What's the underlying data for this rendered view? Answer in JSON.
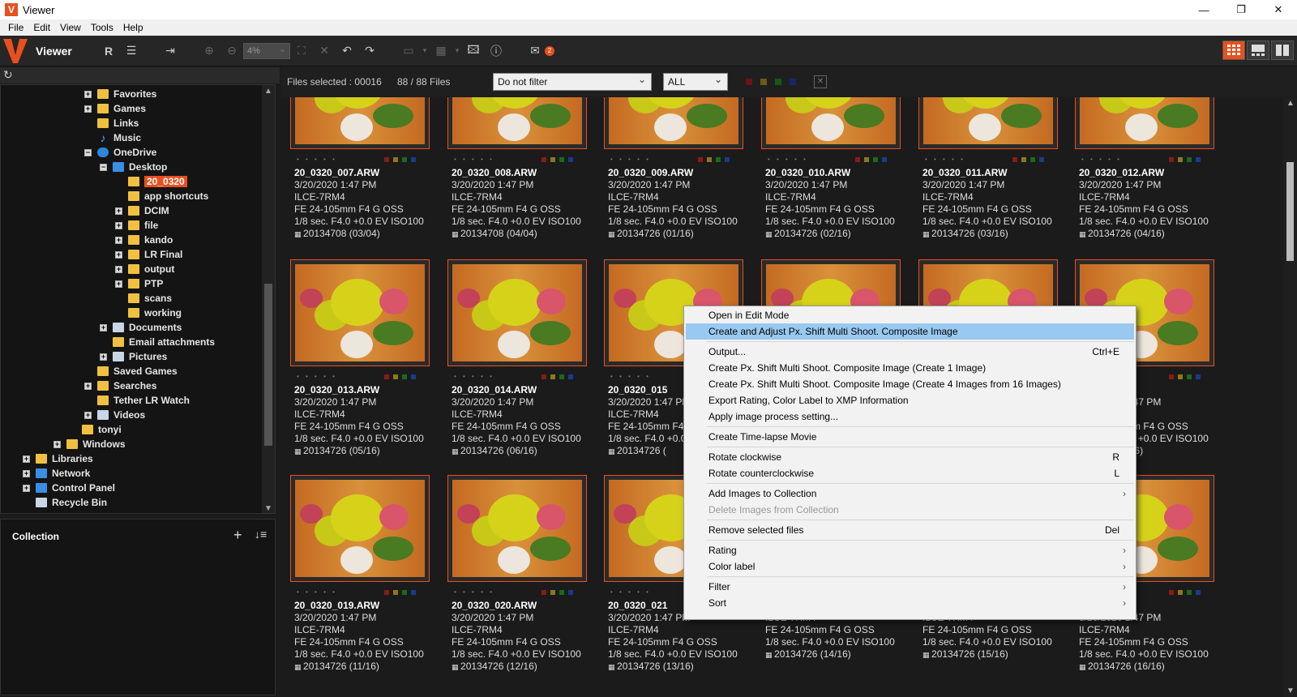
{
  "window": {
    "title": "Viewer",
    "app_icon_letter": "V",
    "controls": [
      "—",
      "❐",
      "✕"
    ]
  },
  "menubar": [
    "File",
    "Edit",
    "View",
    "Tools",
    "Help"
  ],
  "toolbar": {
    "app_name": "Viewer",
    "zoom_value": "4%",
    "mail_badge": "2"
  },
  "tree": {
    "items": [
      {
        "label": "Favorites",
        "level": 5,
        "exp": true,
        "icon": "folder"
      },
      {
        "label": "Games",
        "level": 5,
        "exp": true,
        "icon": "folder"
      },
      {
        "label": "Links",
        "level": 5,
        "exp": false,
        "icon": "folder"
      },
      {
        "label": "Music",
        "level": 5,
        "exp": false,
        "icon": "music"
      },
      {
        "label": "OneDrive",
        "level": 5,
        "exp": "minus",
        "icon": "cloud"
      },
      {
        "label": "Desktop",
        "level": 6,
        "exp": "minus",
        "icon": "blue"
      },
      {
        "label": "20_0320",
        "level": 7,
        "exp": false,
        "icon": "folder",
        "selected": true
      },
      {
        "label": "app shortcuts",
        "level": 7,
        "exp": false,
        "icon": "folder"
      },
      {
        "label": "DCIM",
        "level": 7,
        "exp": true,
        "icon": "folder"
      },
      {
        "label": "file",
        "level": 7,
        "exp": true,
        "icon": "folder"
      },
      {
        "label": "kando",
        "level": 7,
        "exp": true,
        "icon": "folder"
      },
      {
        "label": "LR Final",
        "level": 7,
        "exp": true,
        "icon": "folder"
      },
      {
        "label": "output",
        "level": 7,
        "exp": true,
        "icon": "folder"
      },
      {
        "label": "PTP",
        "level": 7,
        "exp": true,
        "icon": "folder"
      },
      {
        "label": "scans",
        "level": 7,
        "exp": false,
        "icon": "folder"
      },
      {
        "label": "working",
        "level": 7,
        "exp": false,
        "icon": "folder"
      },
      {
        "label": "Documents",
        "level": 6,
        "exp": true,
        "icon": "special"
      },
      {
        "label": "Email attachments",
        "level": 6,
        "exp": false,
        "icon": "folder"
      },
      {
        "label": "Pictures",
        "level": 6,
        "exp": true,
        "icon": "special"
      },
      {
        "label": "Saved Games",
        "level": 5,
        "exp": false,
        "icon": "folder"
      },
      {
        "label": "Searches",
        "level": 5,
        "exp": true,
        "icon": "folder"
      },
      {
        "label": "Tether LR Watch",
        "level": 5,
        "exp": false,
        "icon": "folder"
      },
      {
        "label": "Videos",
        "level": 5,
        "exp": true,
        "icon": "special"
      },
      {
        "label": "tonyi",
        "level": 4,
        "exp": false,
        "icon": "folder"
      },
      {
        "label": "Windows",
        "level": 3,
        "exp": true,
        "icon": "folder"
      },
      {
        "label": "Libraries",
        "level": 1,
        "exp": true,
        "icon": "folder"
      },
      {
        "label": "Network",
        "level": 1,
        "exp": true,
        "icon": "blue"
      },
      {
        "label": "Control Panel",
        "level": 1,
        "exp": true,
        "icon": "blue"
      },
      {
        "label": "Recycle Bin",
        "level": 1,
        "exp": false,
        "icon": "special"
      }
    ]
  },
  "collection": {
    "title": "Collection",
    "add_icon": "+",
    "sort_icon": "↓≡"
  },
  "filterbar": {
    "files_selected": "Files selected : 00016",
    "files_count": "88 / 88 Files",
    "filter_value": "Do not filter",
    "rating_value": "ALL",
    "clear_icon": "✕"
  },
  "grid": {
    "rows": [
      {
        "cells": [
          {
            "name": "20_0320_007.ARW",
            "serial": "20134708 (03/04)"
          },
          {
            "name": "20_0320_008.ARW",
            "serial": "20134708 (04/04)"
          },
          {
            "name": "20_0320_009.ARW",
            "serial": "20134726 (01/16)"
          },
          {
            "name": "20_0320_010.ARW",
            "serial": "20134726 (02/16)"
          },
          {
            "name": "20_0320_011.ARW",
            "serial": "20134726 (03/16)"
          },
          {
            "name": "20_0320_012.ARW",
            "serial": "20134726 (04/16)"
          }
        ]
      },
      {
        "cells": [
          {
            "name": "20_0320_013.ARW",
            "serial": "20134726 (05/16)"
          },
          {
            "name": "20_0320_014.ARW",
            "serial": "20134726 (06/16)"
          },
          {
            "name": "20_0320_015",
            "serial": "20134726 ("
          },
          {
            "name": "",
            "serial": ""
          },
          {
            "name": "",
            "serial": ""
          },
          {
            "name": "0_018.ARW",
            "serial": "4726 (10/16)"
          }
        ]
      },
      {
        "cells": [
          {
            "name": "20_0320_019.ARW",
            "serial": "20134726 (11/16)"
          },
          {
            "name": "20_0320_020.ARW",
            "serial": "20134726 (12/16)"
          },
          {
            "name": "20_0320_021",
            "serial": "20134726 (13/16)"
          },
          {
            "name": "",
            "serial": "20134726 (14/16)"
          },
          {
            "name": "",
            "serial": "20134726 (15/16)"
          },
          {
            "name": "0_024.ARW",
            "serial": "20134726 (16/16)"
          }
        ]
      }
    ],
    "date": "3/20/2020 1:47 PM",
    "camera": "ILCE-7RM4",
    "lens": "FE 24-105mm F4 G OSS",
    "exposure": "1/8 sec. F4.0 +0.0 EV ISO100",
    "rating_dots": "• • • • •"
  },
  "context_menu": {
    "items": [
      {
        "label": "Open in Edit Mode",
        "shortcut": "",
        "sub": false
      },
      {
        "label": "Create and Adjust Px. Shift Multi Shoot. Composite Image",
        "shortcut": "",
        "sub": false,
        "highlight": true
      },
      {
        "sep": true
      },
      {
        "label": "Output...",
        "shortcut": "Ctrl+E",
        "sub": false
      },
      {
        "label": "Create Px. Shift Multi Shoot. Composite Image (Create 1 Image)",
        "shortcut": "",
        "sub": false
      },
      {
        "label": "Create Px. Shift Multi Shoot. Composite Image (Create 4 Images from 16 Images)",
        "shortcut": "",
        "sub": false
      },
      {
        "label": "Export Rating, Color Label to XMP Information",
        "shortcut": "",
        "sub": false
      },
      {
        "label": "Apply image process setting...",
        "shortcut": "",
        "sub": false
      },
      {
        "sep": true
      },
      {
        "label": "Create Time-lapse Movie",
        "shortcut": "",
        "sub": false
      },
      {
        "sep": true
      },
      {
        "label": "Rotate clockwise",
        "shortcut": "R",
        "sub": false
      },
      {
        "label": "Rotate counterclockwise",
        "shortcut": "L",
        "sub": false
      },
      {
        "sep": true
      },
      {
        "label": "Add Images to Collection",
        "shortcut": "",
        "sub": true
      },
      {
        "label": "Delete Images from Collection",
        "shortcut": "",
        "sub": false,
        "disabled": true
      },
      {
        "sep": true
      },
      {
        "label": "Remove selected files",
        "shortcut": "Del",
        "sub": false
      },
      {
        "sep": true
      },
      {
        "label": "Rating",
        "shortcut": "",
        "sub": true
      },
      {
        "label": "Color label",
        "shortcut": "",
        "sub": true
      },
      {
        "sep": true
      },
      {
        "label": "Filter",
        "shortcut": "",
        "sub": true
      },
      {
        "label": "Sort",
        "shortcut": "",
        "sub": true
      }
    ]
  },
  "colors": {
    "accent": "#e8501f",
    "highlight": "#99c9f0",
    "label_red": "#8a1a1a",
    "label_yellow": "#8a7a1a",
    "label_green": "#1a6a1a",
    "label_blue": "#1a3a8a"
  }
}
